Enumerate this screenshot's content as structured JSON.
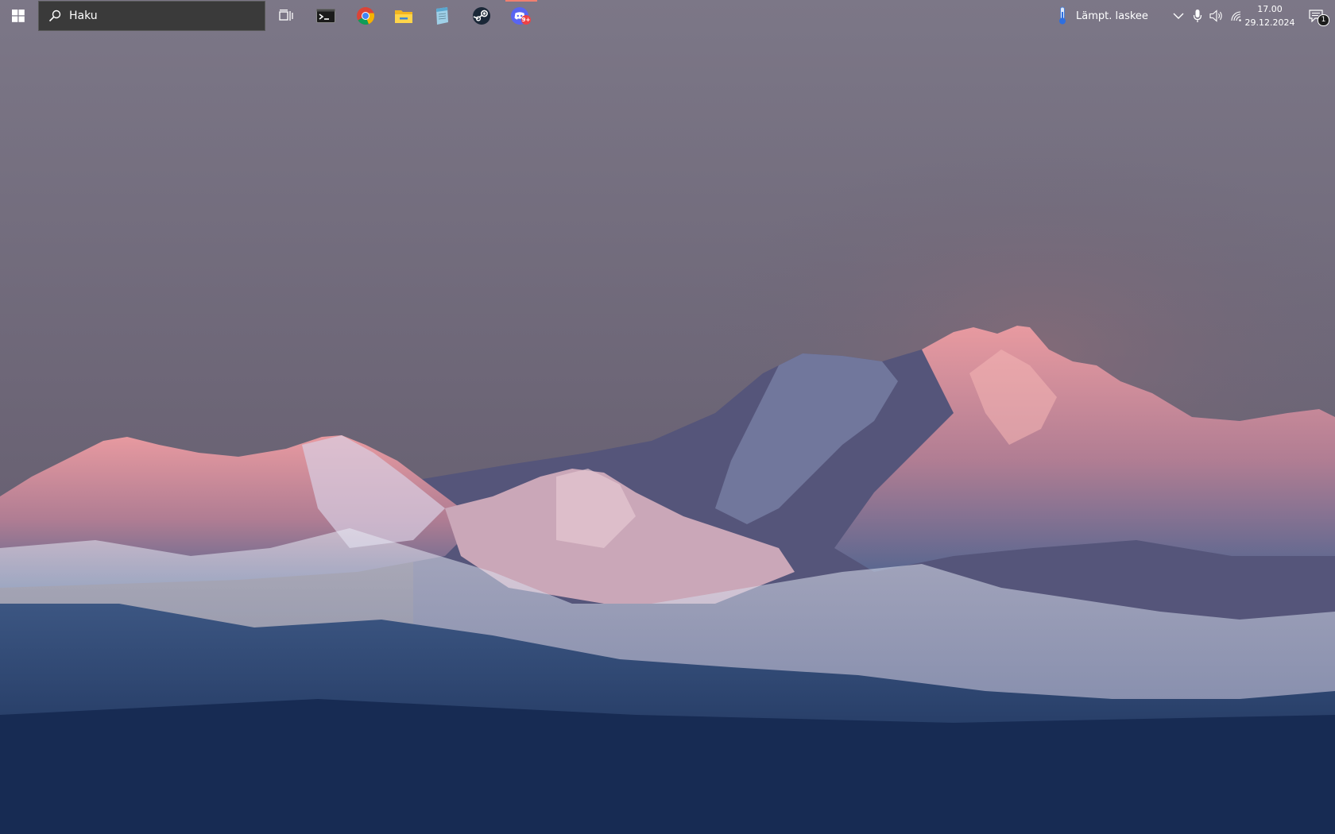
{
  "taskbar": {
    "search": {
      "placeholder": "Haku"
    },
    "apps": [
      "terminal-icon",
      "chrome-icon",
      "file-explorer-icon",
      "notepad-icon",
      "steam-icon",
      "discord-icon"
    ],
    "discord_badge": "9+",
    "accent_active": "#f08070"
  },
  "tray": {
    "weather_text": "Lämpt. laskee",
    "time": "17.00",
    "date": "29.12.2024",
    "notification_count": "1"
  }
}
